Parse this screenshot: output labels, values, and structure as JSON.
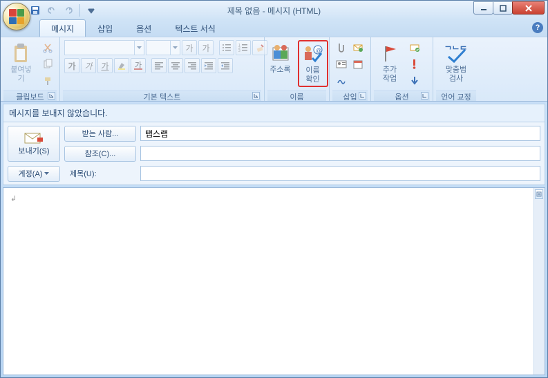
{
  "window": {
    "title": "제목 없음 - 메시지 (HTML)"
  },
  "tabs": {
    "message": "메시지",
    "insert": "삽입",
    "options": "옵션",
    "format": "텍스트 서식"
  },
  "ribbon": {
    "clipboard": {
      "label": "클립보드",
      "paste": "붙여넣기"
    },
    "basictext": {
      "label": "기본 텍스트",
      "bold": "가",
      "italic": "가",
      "underline": "가",
      "grow": "가",
      "shrink": "가"
    },
    "names": {
      "label": "이름",
      "addressbook": "주소록",
      "checknames": "이름\n확인"
    },
    "include": {
      "label": "삽입"
    },
    "options": {
      "label": "옵션",
      "followup": "추가\n작업"
    },
    "proofing": {
      "label": "언어 교정",
      "spelling": "맞춤법\n검사"
    }
  },
  "info_bar": "메시지를 보내지 않았습니다.",
  "header": {
    "send": "보내기(S)",
    "to_btn": "받는 사람...",
    "cc_btn": "참조(C)...",
    "account_btn": "계정(A)",
    "subject_label": "제목(U):",
    "to_value": "탭스랩",
    "cc_value": "",
    "subject_value": ""
  },
  "body": ""
}
